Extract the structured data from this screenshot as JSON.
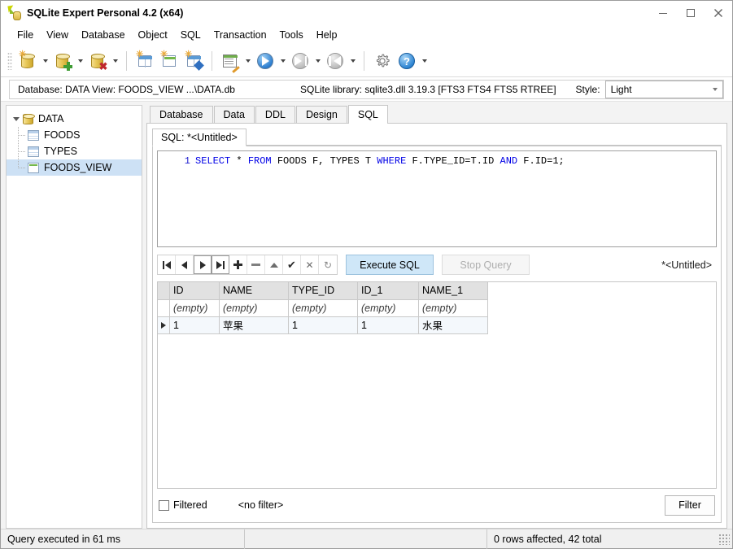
{
  "window": {
    "title": "SQLite Expert Personal 4.2 (x64)",
    "app_icon": "sqlite-expert-icon",
    "controls": {
      "minimize": "minimize-icon",
      "maximize": "maximize-icon",
      "close": "close-icon"
    }
  },
  "menubar": {
    "items": [
      {
        "label": "File"
      },
      {
        "label": "View"
      },
      {
        "label": "Database"
      },
      {
        "label": "Object"
      },
      {
        "label": "SQL"
      },
      {
        "label": "Transaction"
      },
      {
        "label": "Tools"
      },
      {
        "label": "Help"
      }
    ]
  },
  "toolbar": {
    "buttons": [
      {
        "name": "open-database-icon",
        "dropdown": true
      },
      {
        "name": "new-database-icon",
        "dropdown": true
      },
      {
        "name": "delete-database-icon",
        "dropdown": true
      },
      {
        "name": "new-table-icon",
        "dropdown": false
      },
      {
        "name": "new-view-icon",
        "dropdown": false
      },
      {
        "name": "new-index-icon",
        "dropdown": false
      },
      {
        "name": "new-sql-tab-icon",
        "dropdown": true
      },
      {
        "name": "execute-icon",
        "dropdown": true
      },
      {
        "name": "step-forward-icon",
        "dropdown": true
      },
      {
        "name": "step-back-icon",
        "dropdown": true
      },
      {
        "name": "options-gear-icon",
        "dropdown": false
      },
      {
        "name": "help-icon",
        "dropdown": true
      }
    ]
  },
  "infobar": {
    "database_label": "Database: DATA  View: FOODS_VIEW  ...\\DATA.db",
    "library_label": "SQLite library: sqlite3.dll 3.19.3 [FTS3 FTS4 FTS5 RTREE]",
    "style_label": "Style:",
    "style_value": "Light"
  },
  "tree": {
    "nodes": [
      {
        "label": "DATA",
        "icon": "database-icon",
        "level": 0,
        "selected": false,
        "expanded": true
      },
      {
        "label": "FOODS",
        "icon": "table-icon",
        "level": 1,
        "selected": false
      },
      {
        "label": "TYPES",
        "icon": "table-icon",
        "level": 1,
        "selected": false
      },
      {
        "label": "FOODS_VIEW",
        "icon": "view-icon",
        "level": 1,
        "selected": true
      }
    ]
  },
  "tabs": {
    "items": [
      {
        "label": "Database",
        "active": false
      },
      {
        "label": "Data",
        "active": false
      },
      {
        "label": "DDL",
        "active": false
      },
      {
        "label": "Design",
        "active": false
      },
      {
        "label": "SQL",
        "active": true
      }
    ]
  },
  "sql_panel": {
    "inner_tab": "SQL: *<Untitled>",
    "editor": {
      "line_number": "1",
      "tokens": [
        {
          "text": "SELECT",
          "kw": true
        },
        {
          "text": " * ",
          "kw": false
        },
        {
          "text": "FROM",
          "kw": true
        },
        {
          "text": " FOODS F, TYPES T ",
          "kw": false
        },
        {
          "text": "WHERE",
          "kw": true
        },
        {
          "text": " F.TYPE_ID=T.ID ",
          "kw": false
        },
        {
          "text": "AND",
          "kw": true
        },
        {
          "text": " F.ID=1;",
          "kw": false
        }
      ],
      "full_text": "SELECT * FROM FOODS F, TYPES T WHERE F.TYPE_ID=T.ID AND F.ID=1;"
    },
    "navigator": [
      {
        "name": "first-record-button",
        "glyph": "first"
      },
      {
        "name": "prior-record-button",
        "glyph": "prior"
      },
      {
        "name": "next-record-button",
        "glyph": "next"
      },
      {
        "name": "last-record-button",
        "glyph": "last"
      },
      {
        "name": "insert-record-button",
        "glyph": "plus"
      },
      {
        "name": "delete-record-button",
        "glyph": "minus"
      },
      {
        "name": "edit-record-button",
        "glyph": "up"
      },
      {
        "name": "post-edit-button",
        "glyph": "check"
      },
      {
        "name": "cancel-edit-button",
        "glyph": "cross"
      },
      {
        "name": "refresh-button",
        "glyph": "refresh"
      }
    ],
    "execute_label": "Execute SQL",
    "stop_label": "Stop Query",
    "script_name": "*<Untitled>"
  },
  "result_grid": {
    "columns": [
      "ID",
      "NAME",
      "TYPE_ID",
      "ID_1",
      "NAME_1"
    ],
    "filter_row": [
      "(empty)",
      "(empty)",
      "(empty)",
      "(empty)",
      "(empty)"
    ],
    "rows": [
      {
        "selected": true,
        "cells": [
          "1",
          "苹果",
          "1",
          "1",
          "水果"
        ]
      }
    ],
    "align": [
      "right",
      "left",
      "right",
      "right",
      "left"
    ]
  },
  "filter_bar": {
    "checkbox_label": "Filtered",
    "checked": false,
    "filter_text": "<no filter>",
    "filter_button": "Filter"
  },
  "statusbar": {
    "left": "Query executed in 61 ms",
    "middle": "",
    "right": "0 rows affected, 42 total"
  },
  "colors": {
    "accent": "#cfe7f8",
    "selection": "#cde1f5",
    "keyword": "#0000e6",
    "header": "#e1e1e1"
  }
}
